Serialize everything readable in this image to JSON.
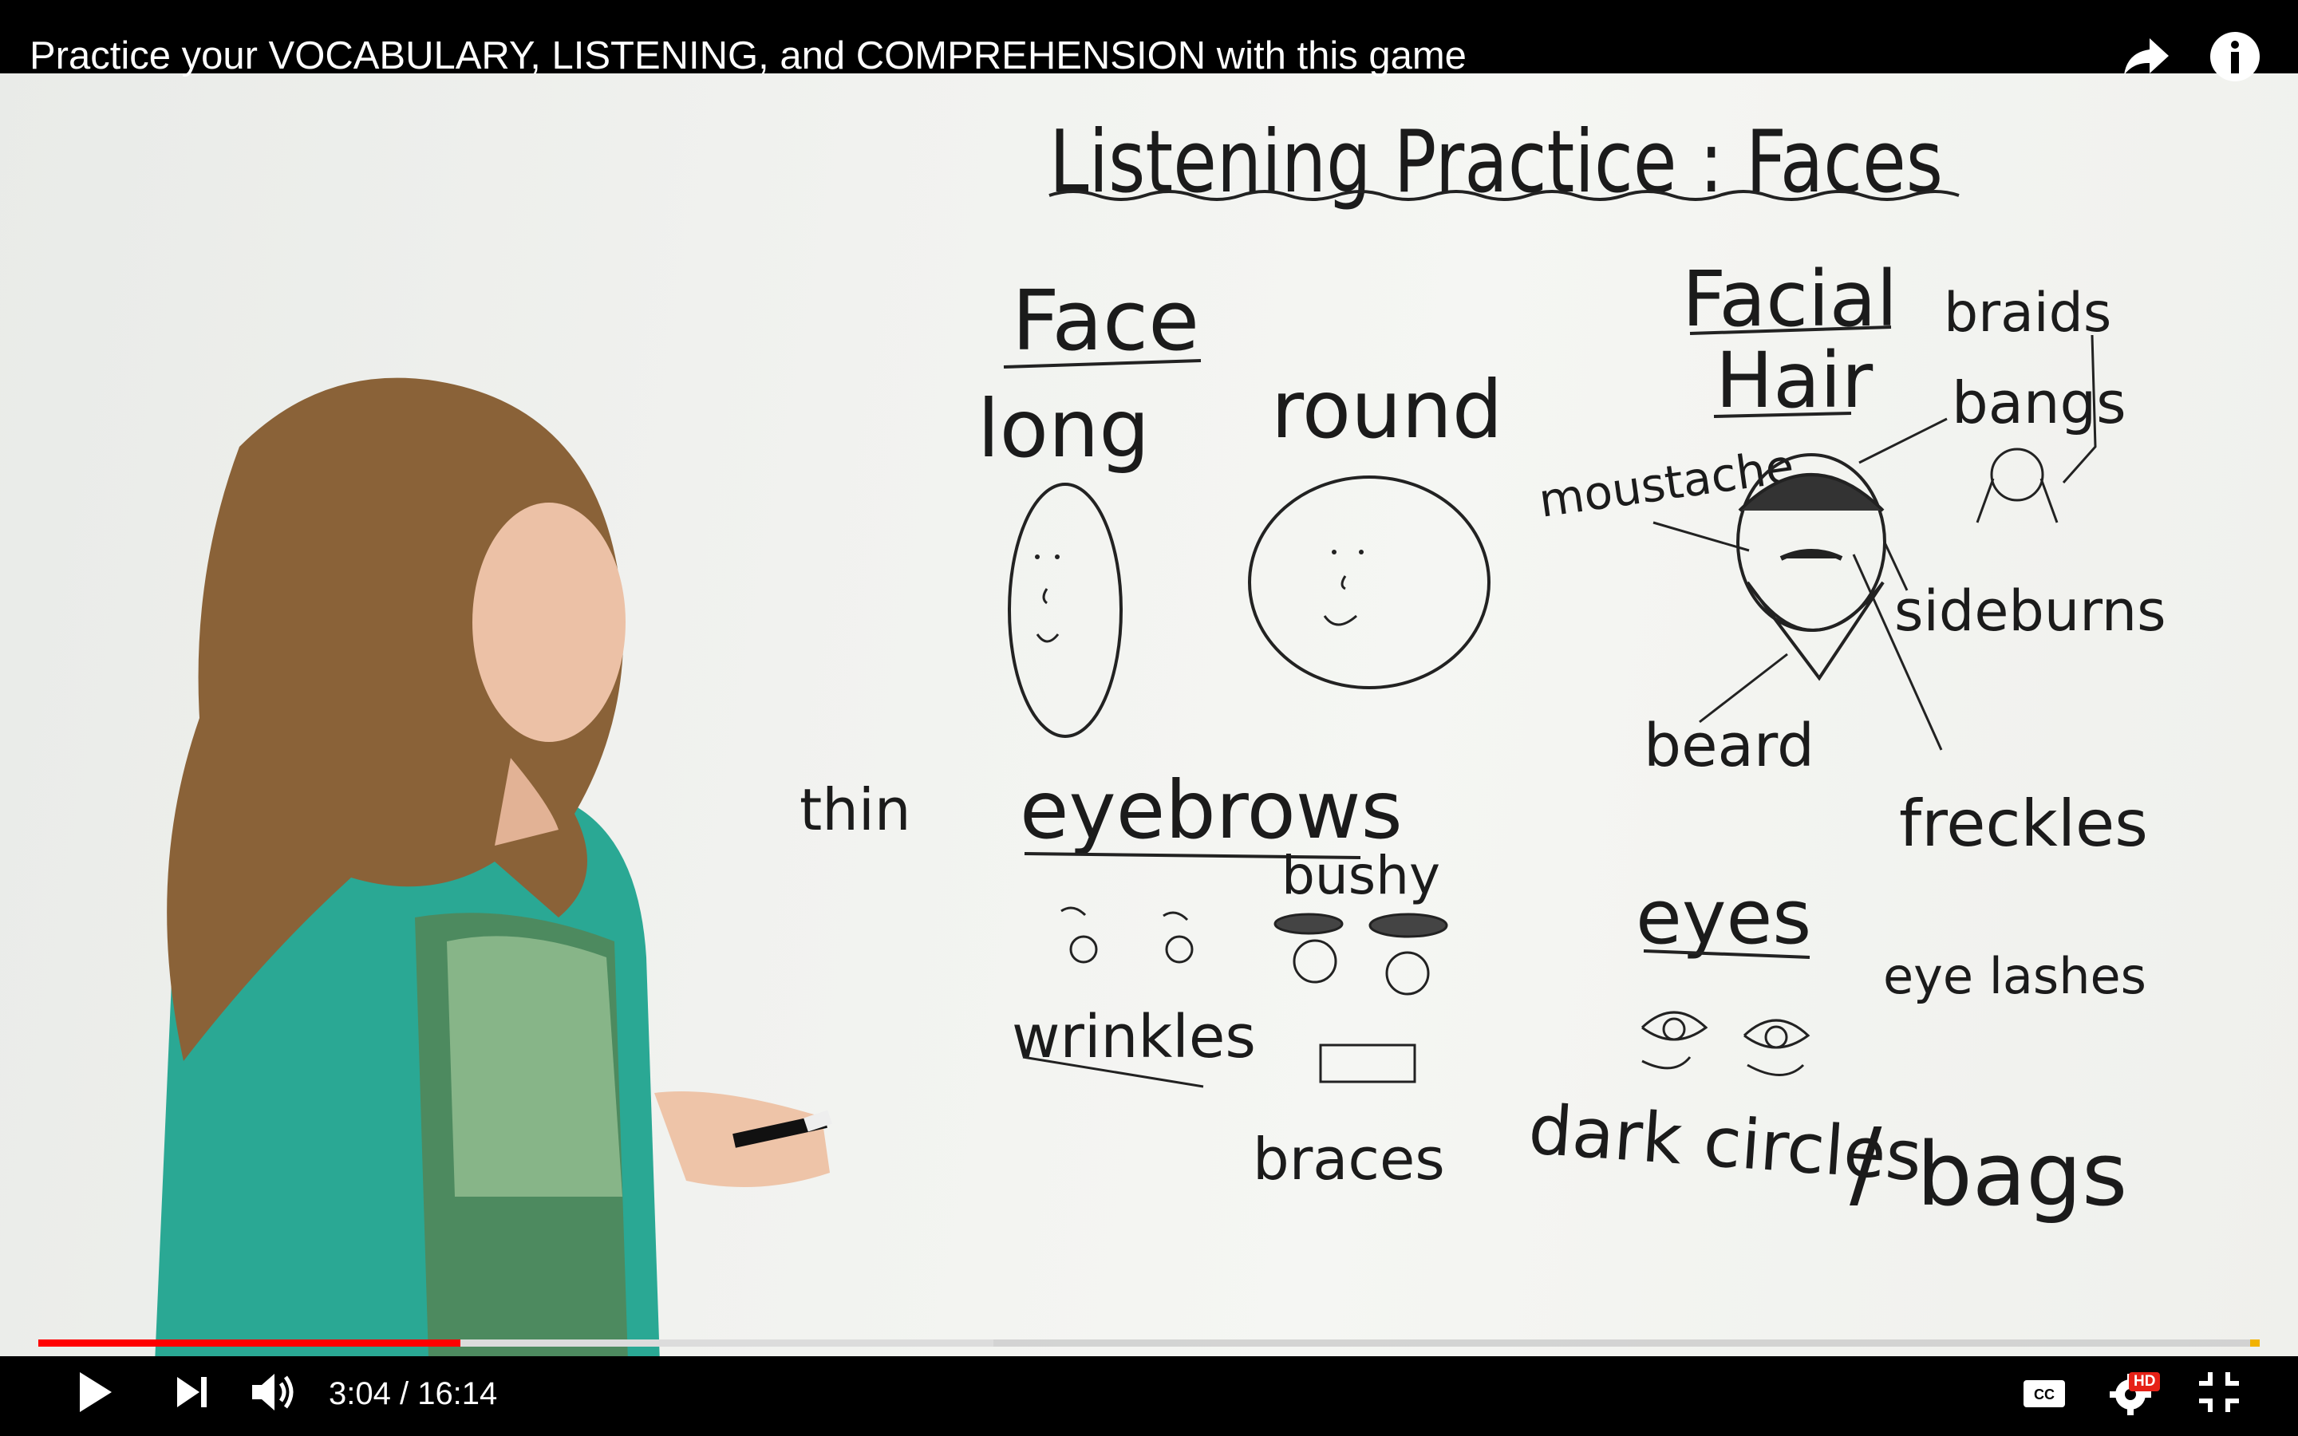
{
  "header": {
    "title": "Practice your VOCABULARY, LISTENING, and COMPREHENSION with this game"
  },
  "icons": {
    "share": "share-icon",
    "info": "info-icon",
    "play": "play-icon",
    "next": "next-icon",
    "volume": "volume-icon",
    "captions": "captions-icon",
    "settings": "settings-gear-icon",
    "exit_fullscreen": "exit-fullscreen-icon"
  },
  "player": {
    "current_time": "3:04",
    "duration": "16:14",
    "time_display": "3:04 / 16:14",
    "played_fraction": 0.19,
    "buffered_fraction": 0.43,
    "quality_badge": "HD",
    "colors": {
      "played": "#ff0000",
      "buffered": "#dcdcdc",
      "track": "#bdbdbd",
      "end_marker": "#f2b200",
      "hd_badge": "#e62117"
    }
  },
  "whiteboard": {
    "title": "Listening Practice : Faces",
    "face_heading": "Face",
    "long": "long",
    "round": "round",
    "facial_heading_1": "Facial",
    "facial_heading_2": "Hair",
    "braids": "braids",
    "bangs": "bangs",
    "moustache": "moustache",
    "sideburns": "sideburns",
    "beard": "beard",
    "freckles": "freckles",
    "thin": "thin",
    "eyebrows": "eyebrows",
    "bushy": "bushy",
    "wrinkles": "wrinkles",
    "braces": "braces",
    "eyes": "eyes",
    "eyelashes": "eye lashes",
    "dark_circles": "dark circles",
    "slash": "/",
    "bags": "bags"
  }
}
